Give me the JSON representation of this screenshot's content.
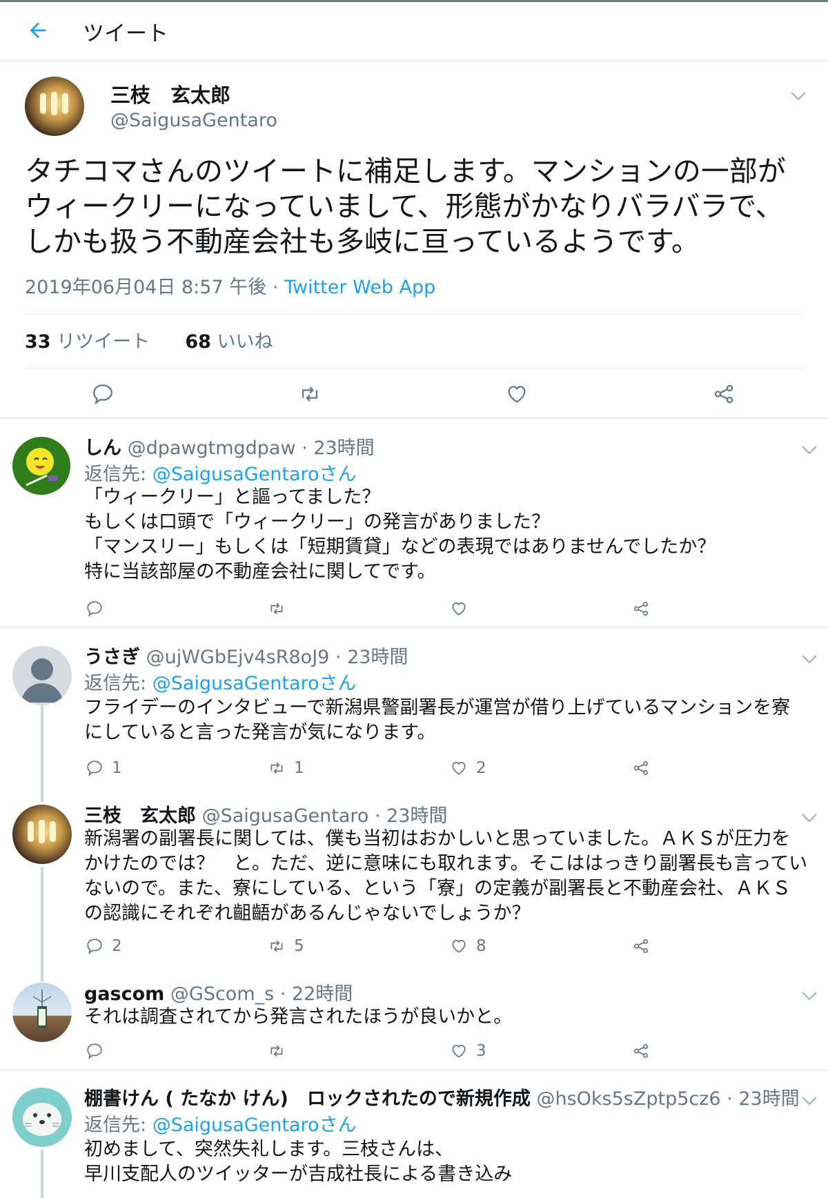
{
  "header": {
    "title": "ツイート"
  },
  "main_tweet": {
    "name": "三枝　玄太郎",
    "handle": "@SaigusaGentaro",
    "text": "タチコマさんのツイートに補足します。マンションの一部がウィークリーになっていまして、形態がかなりバラバラで、しかも扱う不動産会社も多岐に亘っているようです。",
    "datetime": "2019年06月04日 8:57 午後 · ",
    "source": "Twitter Web App",
    "retweets_count": "33",
    "retweets_label": " リツイート",
    "likes_count": "68",
    "likes_label": " いいね"
  },
  "replies": [
    {
      "name": "しん",
      "meta": " @dpawgtmgdpaw · 23時間",
      "reply_to_label": "返信先: ",
      "reply_to": "@SaigusaGentaroさん",
      "text": "「ウィークリー」と謳ってました？\nもしくは口頭で「ウィークリー」の発言がありました？\n「マンスリー」もしくは「短期賃貸」などの表現ではありませんでしたか？\n特に当該部屋の不動産会社に関してです。",
      "replies": "",
      "retweets": "",
      "likes": ""
    },
    {
      "name": "うさぎ",
      "meta": " @ujWGbEjv4sR8oJ9 · 23時間",
      "reply_to_label": "返信先: ",
      "reply_to": "@SaigusaGentaroさん",
      "text": "フライデーのインタビューで新潟県警副署長が運営が借り上げているマンションを寮にしていると言った発言が気になります。",
      "replies": "1",
      "retweets": "1",
      "likes": "2"
    },
    {
      "name": "三枝　玄太郎",
      "meta": " @SaigusaGentaro · 23時間",
      "text": "新潟署の副署長に関しては、僕も当初はおかしいと思っていました。ＡＫＳが圧力をかけたのでは？　と。ただ、逆に意味にも取れます。そこははっきり副署長も言っていないので。また、寮にしている、という「寮」の定義が副署長と不動産会社、ＡＫＳの認識にそれぞれ齟齬があるんじゃないでしょうか？",
      "replies": "2",
      "retweets": "5",
      "likes": "8"
    },
    {
      "name": "gascom",
      "meta": " @GScom_s · 22時間",
      "text": "それは調査されてから発言されたほうが良いかと。",
      "replies": "",
      "retweets": "",
      "likes": "3"
    },
    {
      "name": "棚書けん ( たなか けん)　ロックされたので新規作成",
      "meta": " @hsOks5sZptp5cz6 · 23時間",
      "reply_to_label": "返信先: ",
      "reply_to": "@SaigusaGentaroさん",
      "text": "初めまして、突然失礼します。三枝さんは、\n早川支配人のツイッターが吉成社長による書き込み"
    }
  ],
  "colors": {
    "accent": "#1da1f2",
    "secondary_text": "#657786",
    "primary_text": "#14171a",
    "border": "#e6ecf0"
  },
  "icons": [
    "back-arrow-icon",
    "chevron-down-icon",
    "reply-icon",
    "retweet-icon",
    "like-icon",
    "share-icon"
  ]
}
